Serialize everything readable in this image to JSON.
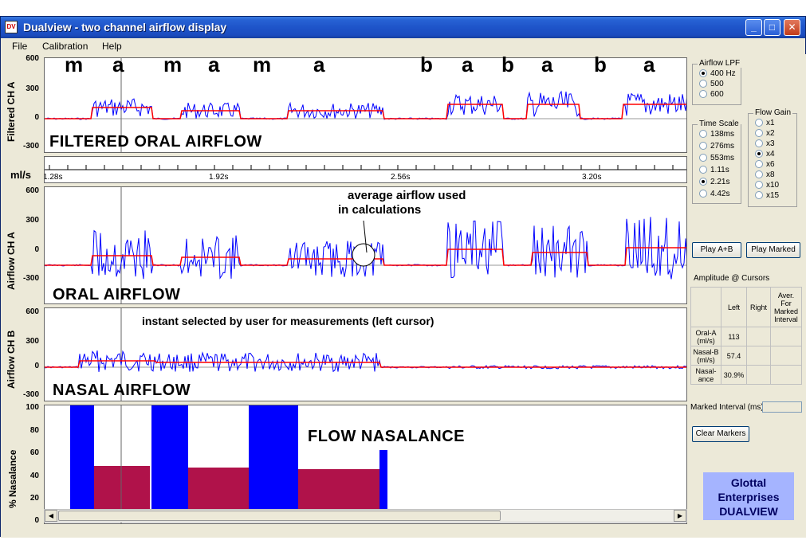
{
  "window": {
    "title": "Dualview - two channel airflow display",
    "icon_text": "DV",
    "min": "_",
    "max": "□",
    "close": "✕"
  },
  "menu": [
    "File",
    "Calibration",
    "Help"
  ],
  "panels": {
    "filtered": {
      "ylabel": "Filtered CH A",
      "label": "FILTERED ORAL AIRFLOW",
      "ticks": [
        "600",
        "300",
        "0",
        "-300"
      ]
    },
    "time": {
      "unit": "ml/s",
      "ticks": [
        "1.28s",
        "1.92s",
        "2.56s",
        "3.20s"
      ]
    },
    "oral": {
      "ylabel": "Airflow CH A",
      "label": "ORAL AIRFLOW",
      "ticks": [
        "600",
        "300",
        "0",
        "-300"
      ],
      "annotation": "average airflow used in calculations",
      "annotation_line1": "average airflow used",
      "annotation_line2": "in calculations"
    },
    "nasal": {
      "ylabel": "Airflow CH B",
      "label": "NASAL AIRFLOW",
      "ticks": [
        "600",
        "300",
        "0",
        "-300"
      ],
      "annotation": "instant selected by user for measurements (left cursor)"
    },
    "nasalance": {
      "ylabel": "% Nasalance",
      "label": "FLOW NASALANCE",
      "ticks": [
        "100",
        "80",
        "60",
        "40",
        "20",
        "0"
      ]
    }
  },
  "phonemes": [
    "m",
    "a",
    "m",
    "a",
    "m",
    "a",
    "b",
    "a",
    "b",
    "a",
    "b",
    "a"
  ],
  "side": {
    "lpf": {
      "title": "Airflow LPF",
      "options": [
        "400 Hz",
        "500",
        "600"
      ],
      "selected": 0
    },
    "timescale": {
      "title": "Time Scale",
      "options": [
        "138ms",
        "276ms",
        "553ms",
        "1.11s",
        "2.21s",
        "4.42s"
      ],
      "selected": 4
    },
    "gain": {
      "title": "Flow Gain",
      "options": [
        "x1",
        "x2",
        "x3",
        "x4",
        "x6",
        "x8",
        "x10",
        "x15"
      ],
      "selected": 3
    },
    "play_ab": "Play A+B",
    "play_marked": "Play Marked",
    "amp_title": "Amplitude @ Cursors",
    "amp_headers": [
      "",
      "Left",
      "Right",
      "Aver. For Marked Interval"
    ],
    "amp_rows": [
      {
        "label": "Oral-A (ml/s)",
        "left": "113",
        "right": "",
        "aver": ""
      },
      {
        "label": "Nasal-B (ml/s)",
        "left": "57.4",
        "right": "",
        "aver": ""
      },
      {
        "label": "Nasal-ance",
        "left": "30.9%",
        "right": "",
        "aver": ""
      }
    ],
    "marked_interval": "Marked Interval (ms):",
    "clear_markers": "Clear Markers",
    "brand_line1": "Glottal",
    "brand_line2": "Enterprises",
    "brand_line3": "DUALVIEW"
  },
  "colors": {
    "signal": "#0000ff",
    "average": "#ff0000",
    "nasalance_fill": "#b0124a",
    "nasalance_peak": "#0000ff",
    "titlebar": "#1e54c9"
  }
}
